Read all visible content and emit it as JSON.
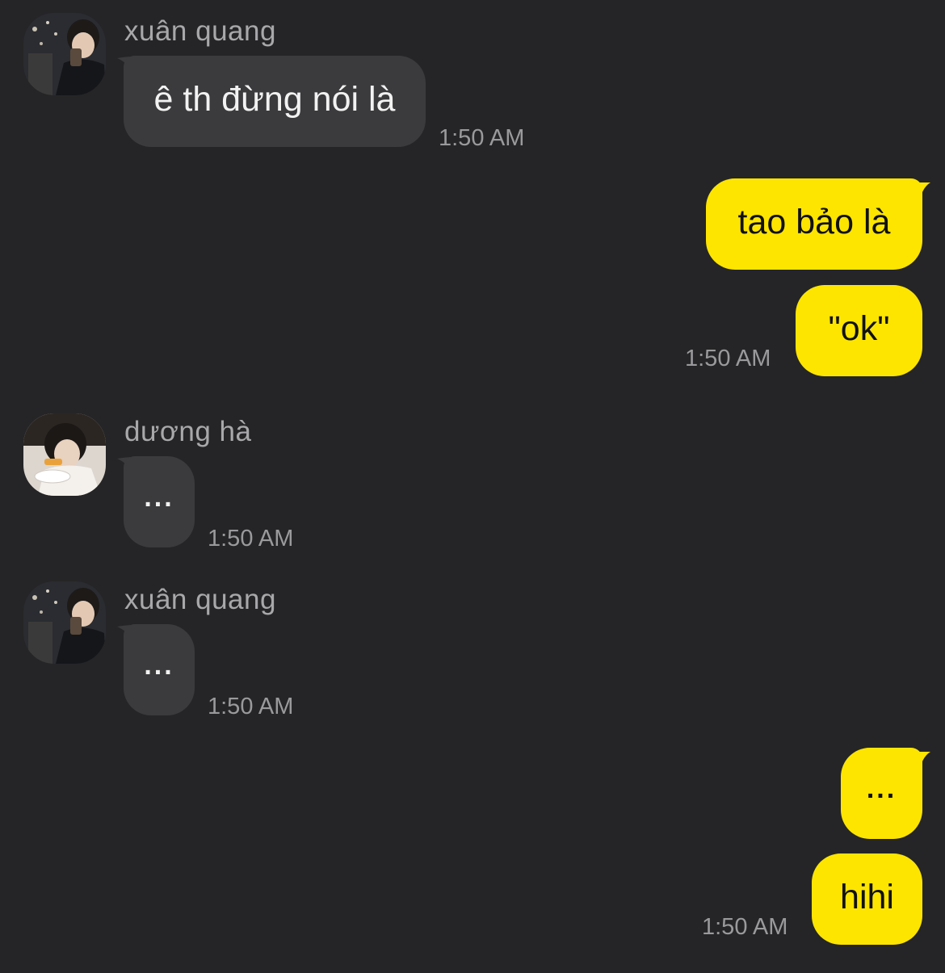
{
  "colors": {
    "background": "#252527",
    "incoming_bubble": "#3b3b3e",
    "outgoing_bubble": "#fee500",
    "sender_name": "#a8a8ab",
    "timestamp": "#9a9a9d"
  },
  "messages": [
    {
      "sender": "xuân quang",
      "avatar_icon": "user-avatar-xuan-quang",
      "bubbles": [
        {
          "text": "ê th đừng nói là"
        }
      ],
      "time": "1:50 AM"
    },
    {
      "sender": "me",
      "bubbles": [
        {
          "text": "tao bảo là"
        },
        {
          "text": "\"ok\""
        }
      ],
      "time": "1:50 AM"
    },
    {
      "sender": "dương hà",
      "avatar_icon": "user-avatar-duong-ha",
      "bubbles": [
        {
          "text": "..."
        }
      ],
      "time": "1:50 AM"
    },
    {
      "sender": "xuân quang",
      "avatar_icon": "user-avatar-xuan-quang",
      "bubbles": [
        {
          "text": "..."
        }
      ],
      "time": "1:50 AM"
    },
    {
      "sender": "me",
      "bubbles": [
        {
          "text": "..."
        },
        {
          "text": "hihi"
        }
      ],
      "time": "1:50 AM"
    }
  ]
}
